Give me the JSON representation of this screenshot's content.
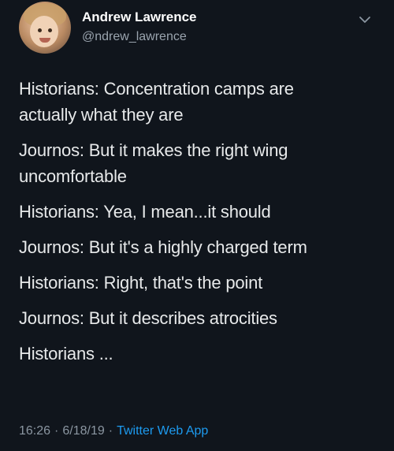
{
  "author": {
    "display_name": "Andrew Lawrence",
    "handle": "@ndrew_lawrence",
    "avatar_icon": "child-portrait-avatar"
  },
  "menu_icon": "chevron-down-icon",
  "tweet": {
    "lines": [
      "Historians: Concentration camps are",
      "actually what they are",
      "Journos: But it makes the right wing",
      "uncomfortable",
      "Historians: Yea, I mean...it should",
      "Journos: But it's a highly charged term",
      "Historians: Right, that's the point",
      "Journos: But it describes atrocities",
      "Historians ..."
    ]
  },
  "meta": {
    "time": "16:26",
    "separator": "·",
    "date": "6/18/19",
    "source": "Twitter Web App"
  },
  "colors": {
    "background": "#10151c",
    "text": "#e7e9ea",
    "muted": "#8b96a1",
    "link": "#1d9bf0"
  }
}
